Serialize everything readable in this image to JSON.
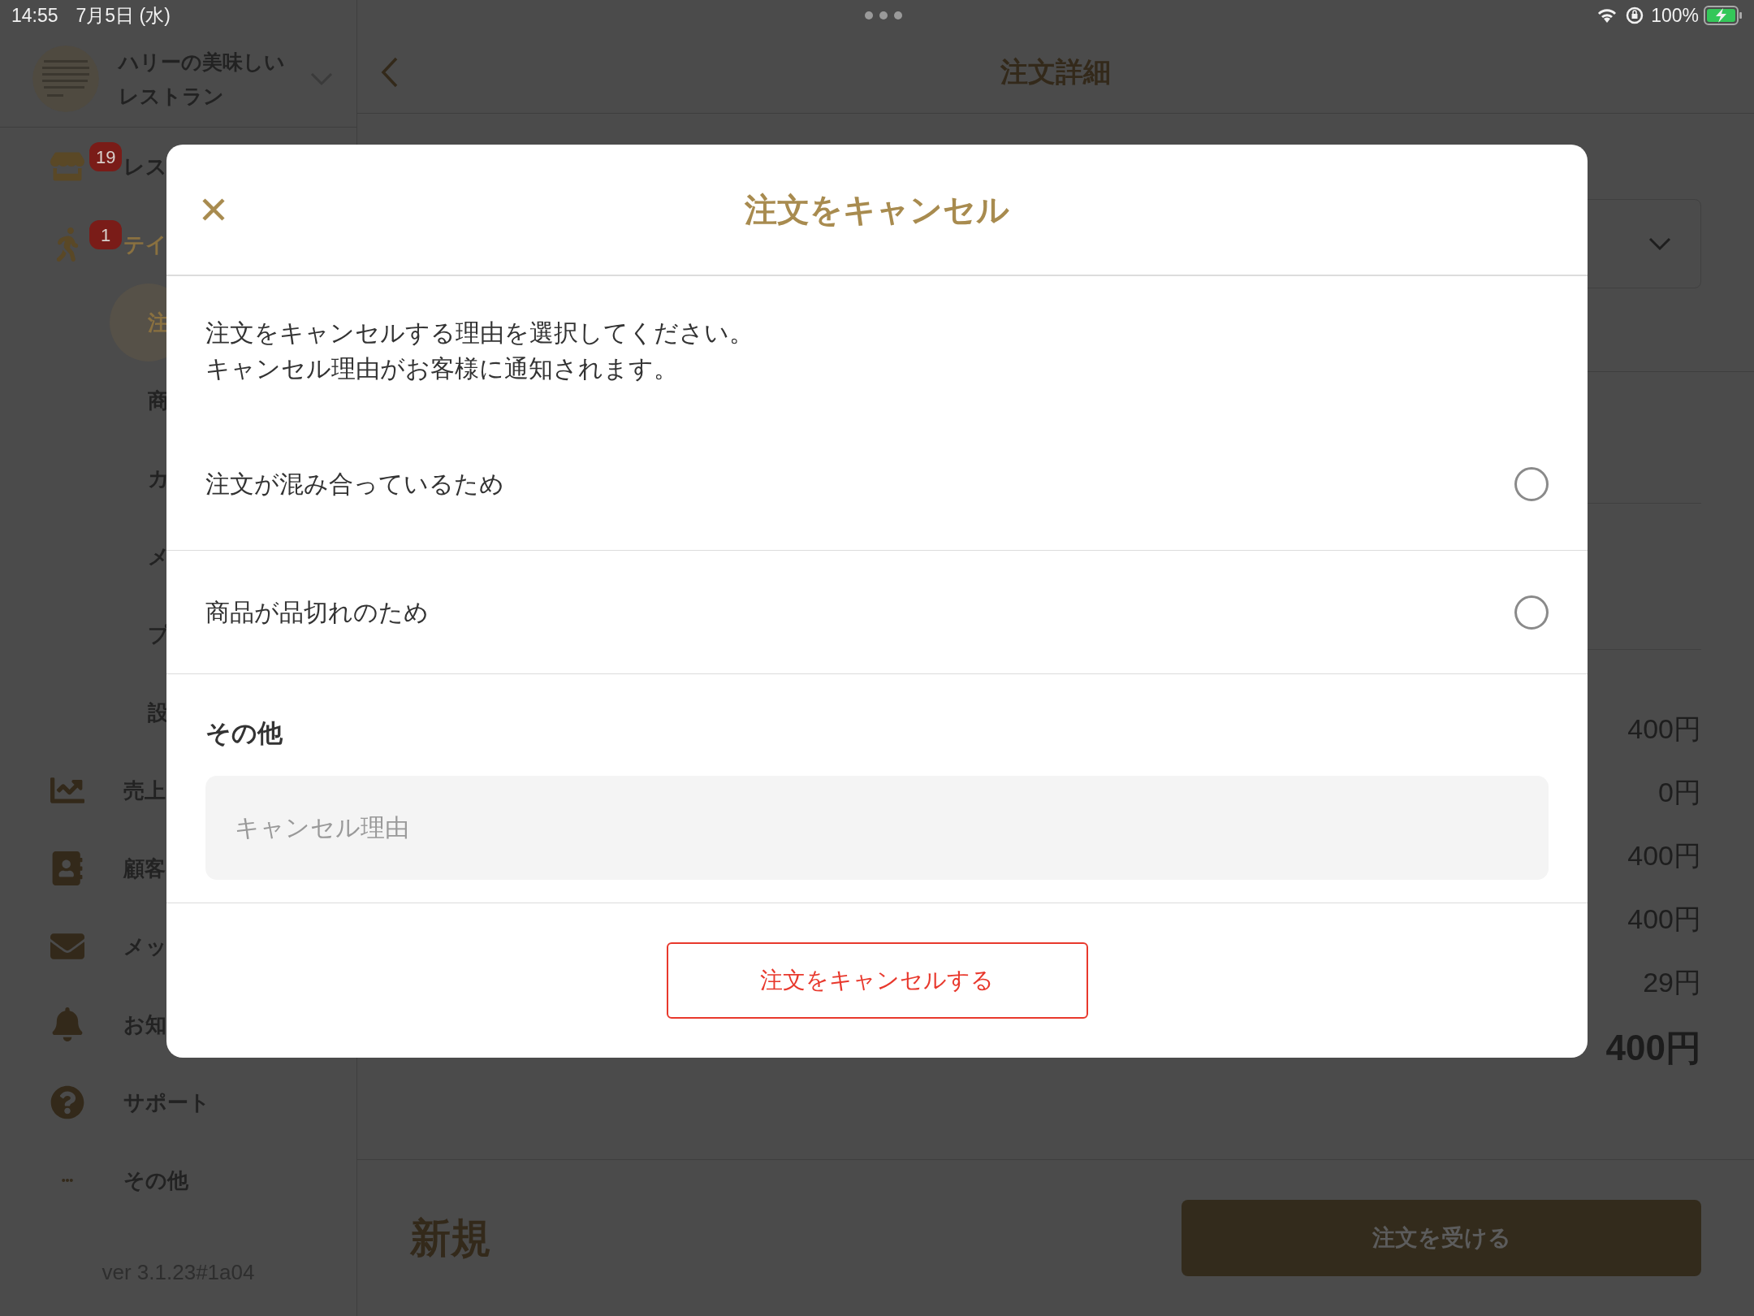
{
  "status_bar": {
    "time": "14:55",
    "date": "7月5日 (水)",
    "battery": "100%"
  },
  "sidebar": {
    "restaurant_name": [
      "ハリーの美味しい",
      "レストラン"
    ],
    "items": [
      {
        "label": "レス",
        "kind": "main",
        "badge": "19",
        "selected": false
      },
      {
        "label": "テイ",
        "kind": "main",
        "badge": "1",
        "selected": true
      },
      {
        "label": "注",
        "kind": "sub",
        "selected": true
      },
      {
        "label": "商",
        "kind": "sub",
        "selected": false
      },
      {
        "label": "カ",
        "kind": "sub",
        "selected": false
      },
      {
        "label": "メ",
        "kind": "sub",
        "selected": false
      },
      {
        "label": "プ",
        "kind": "sub",
        "selected": false
      },
      {
        "label": "設",
        "kind": "sub",
        "selected": false
      },
      {
        "label": "売上",
        "kind": "main",
        "selected": false
      },
      {
        "label": "顧客",
        "kind": "main",
        "selected": false
      },
      {
        "label": "メッ",
        "kind": "main",
        "selected": false
      },
      {
        "label": "お知",
        "kind": "main",
        "selected": false
      },
      {
        "label": "サポート",
        "kind": "main",
        "selected": false
      },
      {
        "label": "その他",
        "kind": "main",
        "selected": false
      }
    ],
    "version": "ver 3.1.23#1a04"
  },
  "main": {
    "title": "注文詳細",
    "amounts": [
      {
        "value": "400円",
        "kind": "line"
      },
      {
        "value": "0円",
        "kind": "line"
      },
      {
        "value": "400円",
        "kind": "line"
      },
      {
        "value": "400円",
        "kind": "line"
      },
      {
        "value": "29円",
        "kind": "line"
      },
      {
        "value": "400円",
        "kind": "total"
      }
    ],
    "status": "新規",
    "accept_button": "注文を受ける"
  },
  "modal": {
    "title": "注文をキャンセル",
    "description": [
      "注文をキャンセルする理由を選択してください。",
      "キャンセル理由がお客様に通知されます。"
    ],
    "options": [
      {
        "label": "注文が混み合っているため",
        "selected": false
      },
      {
        "label": "商品が品切れのため",
        "selected": false
      }
    ],
    "other_heading": "その他",
    "placeholder": "キャンセル理由",
    "submit": "注文をキャンセルする"
  }
}
